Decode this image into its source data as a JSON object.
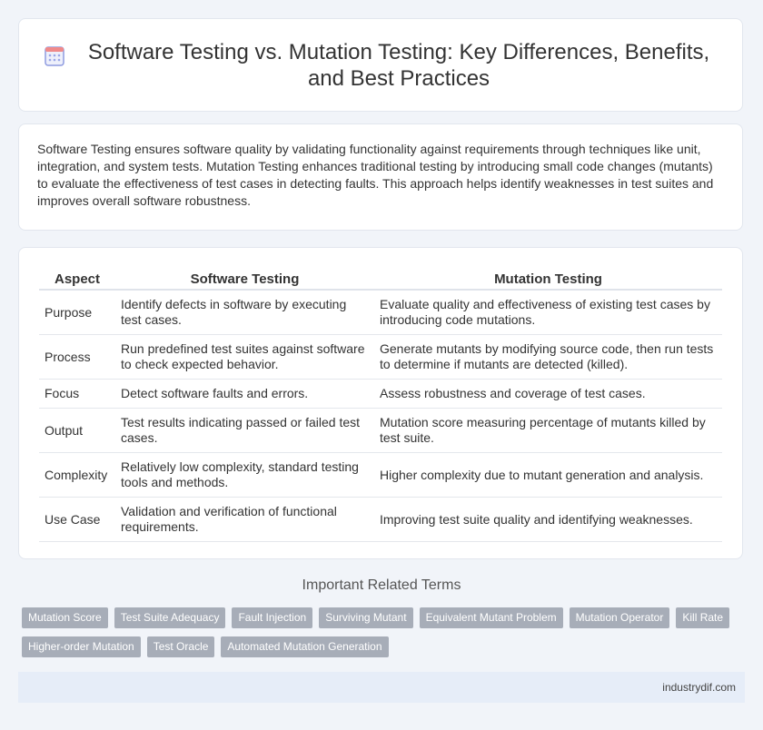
{
  "header": {
    "icon": "calendar-icon",
    "title": "Software Testing vs. Mutation Testing: Key Differences, Benefits, and Best Practices"
  },
  "intro": {
    "text": "Software Testing ensures software quality by validating functionality against requirements through techniques like unit, integration, and system tests. Mutation Testing enhances traditional testing by introducing small code changes (mutants) to evaluate the effectiveness of test cases in detecting faults. This approach helps identify weaknesses in test suites and improves overall software robustness."
  },
  "table": {
    "headers": [
      "Aspect",
      "Software Testing",
      "Mutation Testing"
    ],
    "rows": [
      [
        "Purpose",
        "Identify defects in software by executing test cases.",
        "Evaluate quality and effectiveness of existing test cases by introducing code mutations."
      ],
      [
        "Process",
        "Run predefined test suites against software to check expected behavior.",
        "Generate mutants by modifying source code, then run tests to determine if mutants are detected (killed)."
      ],
      [
        "Focus",
        "Detect software faults and errors.",
        "Assess robustness and coverage of test cases."
      ],
      [
        "Output",
        "Test results indicating passed or failed test cases.",
        "Mutation score measuring percentage of mutants killed by test suite."
      ],
      [
        "Complexity",
        "Relatively low complexity, standard testing tools and methods.",
        "Higher complexity due to mutant generation and analysis."
      ],
      [
        "Use Case",
        "Validation and verification of functional requirements.",
        "Improving test suite quality and identifying weaknesses."
      ]
    ]
  },
  "related": {
    "title": "Important Related Terms",
    "tags": [
      "Mutation Score",
      "Test Suite Adequacy",
      "Fault Injection",
      "Surviving Mutant",
      "Equivalent Mutant Problem",
      "Mutation Operator",
      "Kill Rate",
      "Higher-order Mutation",
      "Test Oracle",
      "Automated Mutation Generation"
    ]
  },
  "footer": {
    "site": "industrydif.com"
  }
}
